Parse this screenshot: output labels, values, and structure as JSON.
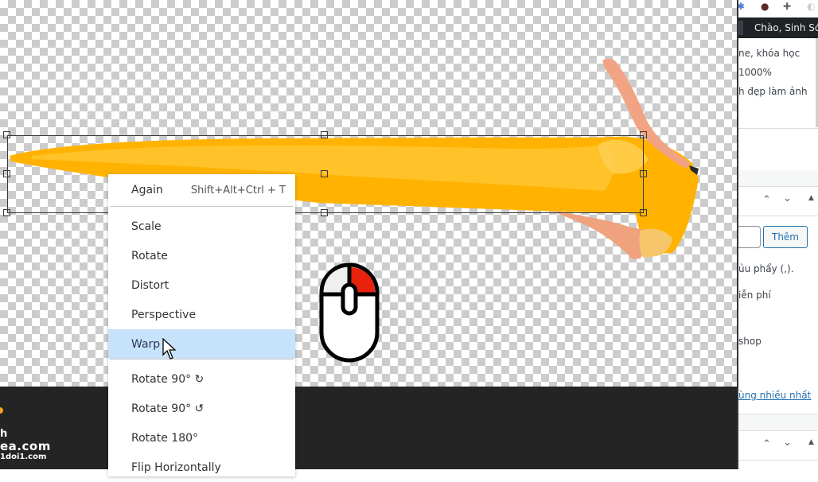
{
  "editor": {
    "context_menu": {
      "items": [
        {
          "label": "Again",
          "shortcut": "Shift+Alt+Ctrl + T"
        },
        {
          "label": "Scale"
        },
        {
          "label": "Rotate"
        },
        {
          "label": "Distort"
        },
        {
          "label": "Perspective"
        },
        {
          "label": "Warp",
          "selected": true
        },
        {
          "label": "Rotate 90° ↻"
        },
        {
          "label": "Rotate 90° ↺"
        },
        {
          "label": "Rotate 180°"
        },
        {
          "label": "Flip Horizontally"
        }
      ]
    },
    "mouse_hint": {
      "icon": "mouse-right-click-icon",
      "highlight_color": "#e8220c"
    },
    "artwork_colors": {
      "dress": "#ffb400",
      "skin": "#f4a882"
    },
    "watermark": {
      "line1": "h",
      "line2": "ea.com",
      "line3": "1doi1.com"
    }
  },
  "wp_panel": {
    "admin_bar": {
      "greeting": "Chào, Sinh Sói"
    },
    "snippets": {
      "line1": "ne, khóa học",
      "line2": "1000%",
      "line3": "h đẹp làm ảnh"
    },
    "tags_box": {
      "add_button": "Thêm",
      "hint": "ủu phẩy (,).",
      "tag_line1": "iễn phí",
      "tag_line2": "shop",
      "most_used_link": "ùng nhiều nhất"
    },
    "icons": {
      "move_up": "chevron-up-icon",
      "move_down": "chevron-down-icon",
      "toggle": "triangle-up-icon"
    }
  }
}
